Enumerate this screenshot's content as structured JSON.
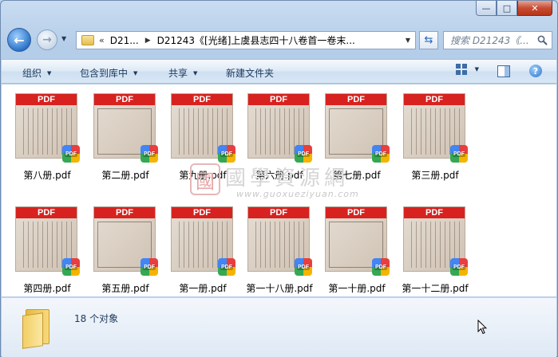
{
  "window": {
    "minimize_label": "—",
    "maximize_label": "□",
    "close_label": "✕"
  },
  "nav": {
    "back_glyph": "←",
    "forward_glyph": "→",
    "address": {
      "chevrons": "«",
      "crumbs": [
        "D21...",
        "D21243《[光绪]上虞县志四十八卷首一卷末..."
      ]
    },
    "search_placeholder": "搜索 D21243《..."
  },
  "toolbar": {
    "organize": "组织",
    "include_in_library": "包含到库中",
    "share": "共享",
    "new_folder": "新建文件夹"
  },
  "files": [
    {
      "name": "第八册.pdf",
      "badge": "PDF"
    },
    {
      "name": "第二册.pdf",
      "badge": "PDF"
    },
    {
      "name": "第九册.pdf",
      "badge": "PDF"
    },
    {
      "name": "第六册.pdf",
      "badge": "PDF"
    },
    {
      "name": "第七册.pdf",
      "badge": "PDF"
    },
    {
      "name": "第三册.pdf",
      "badge": "PDF"
    },
    {
      "name": "第四册.pdf",
      "badge": "PDF"
    },
    {
      "name": "第五册.pdf",
      "badge": "PDF"
    },
    {
      "name": "第一册.pdf",
      "badge": "PDF"
    },
    {
      "name": "第一十八册.pdf",
      "badge": "PDF"
    },
    {
      "name": "第一十册.pdf",
      "badge": "PDF"
    },
    {
      "name": "第一十二册.pdf",
      "badge": "PDF"
    }
  ],
  "watermark": {
    "seal": "國",
    "text": "國學資源網",
    "url": "www.guoxueziyuan.com"
  },
  "details": {
    "count_text": "18 个对象"
  },
  "colors": {
    "pdf_banner": "#d7221f",
    "window_frame": "#b4cde8"
  }
}
